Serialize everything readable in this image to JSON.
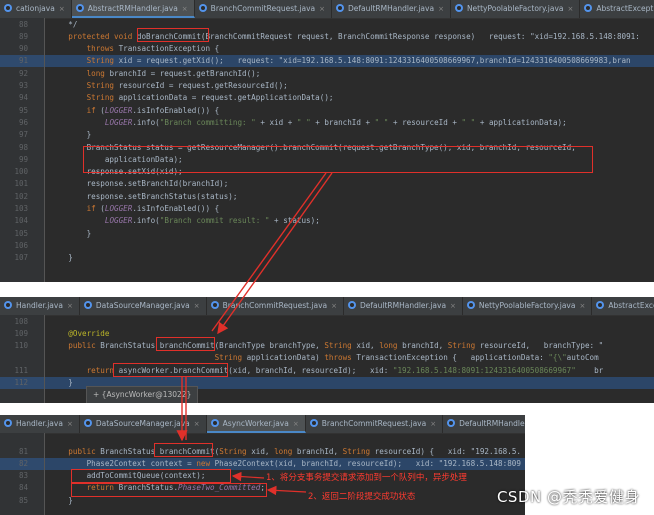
{
  "panel1": {
    "tabs": [
      {
        "label": "cationjava",
        "active": false
      },
      {
        "label": "AbstractRMHandler.java",
        "active": true
      },
      {
        "label": "BranchCommitRequest.java",
        "active": false
      },
      {
        "label": "DefaultRMHandler.java",
        "active": false
      },
      {
        "label": "NettyPoolableFactory.java",
        "active": false
      },
      {
        "label": "AbstractExceptionHandler.java",
        "active": false
      },
      {
        "label": "AbstractT",
        "active": false
      }
    ],
    "lines": [
      {
        "n": "88",
        "code": "    */"
      },
      {
        "n": "89",
        "code": "    protected void doBranchCommit(BranchCommitRequest request, BranchCommitResponse response)   request: \"xid=192.168.5.148:8091:"
      },
      {
        "n": "90",
        "code": "        throws TransactionException {"
      },
      {
        "n": "91",
        "code": "        String xid = request.getXid();   request: \"xid=192.168.5.148:8091:1243316400508669967,branchId=1243316400508669983,bran"
      },
      {
        "n": "92",
        "code": "        long branchId = request.getBranchId();"
      },
      {
        "n": "93",
        "code": "        String resourceId = request.getResourceId();"
      },
      {
        "n": "94",
        "code": "        String applicationData = request.getApplicationData();"
      },
      {
        "n": "95",
        "code": "        if (LOGGER.isInfoEnabled()) {"
      },
      {
        "n": "96",
        "code": "            LOGGER.info(\"Branch committing: \" + xid + \" \" + branchId + \" \" + resourceId + \" \" + applicationData);"
      },
      {
        "n": "97",
        "code": "        }"
      },
      {
        "n": "98",
        "code": "        BranchStatus status = getResourceManager().branchCommit(request.getBranchType(), xid, branchId, resourceId,"
      },
      {
        "n": "99",
        "code": "            applicationData);"
      },
      {
        "n": "100",
        "code": "        response.setXid(xid);"
      },
      {
        "n": "101",
        "code": "        response.setBranchId(branchId);"
      },
      {
        "n": "102",
        "code": "        response.setBranchStatus(status);"
      },
      {
        "n": "103",
        "code": "        if (LOGGER.isInfoEnabled()) {"
      },
      {
        "n": "104",
        "code": "            LOGGER.info(\"Branch commit result: \" + status);"
      },
      {
        "n": "105",
        "code": "        }"
      },
      {
        "n": "106",
        "code": ""
      },
      {
        "n": "107",
        "code": "    }"
      }
    ]
  },
  "panel2": {
    "tabs": [
      {
        "label": "Handler.java",
        "active": false
      },
      {
        "label": "DataSourceManager.java",
        "active": false
      },
      {
        "label": "BranchCommitRequest.java",
        "active": false
      },
      {
        "label": "DefaultRMHandler.java",
        "active": false
      },
      {
        "label": "NettyPoolableFactory.java",
        "active": false
      },
      {
        "label": "AbstractExceptionHandler.java",
        "active": false
      }
    ],
    "lines": [
      {
        "n": "108",
        "code": ""
      },
      {
        "n": "109",
        "code": "    @Override"
      },
      {
        "n": "110",
        "code": "    public BranchStatus branchCommit(BranchType branchType, String xid, long branchId, String resourceId,   branchType: \""
      },
      {
        "n": "",
        "code": "                                    String applicationData) throws TransactionException {   applicationData: \"{\\\"autoCom"
      },
      {
        "n": "111",
        "code": "        return asyncWorker.branchCommit(xid, branchId, resourceId);   xid: \"192.168.5.148:8091:1243316400508669967\"    br"
      },
      {
        "n": "112",
        "code": "    }"
      }
    ],
    "tooltip": "+ {AsyncWorker@13022}"
  },
  "panel3": {
    "tabs": [
      {
        "label": "Handler.java",
        "active": false
      },
      {
        "label": "DataSourceManager.java",
        "active": false
      },
      {
        "label": "AsyncWorker.java",
        "active": true
      },
      {
        "label": "BranchCommitRequest.java",
        "active": false
      },
      {
        "label": "DefaultRMHandler.java",
        "active": false
      },
      {
        "label": "NettyPoolableFactory.java",
        "active": false
      }
    ],
    "lines": [
      {
        "n": "81",
        "code": "    public BranchStatus branchCommit(String xid, long branchId, String resourceId) {   xid: \"192.168.5."
      },
      {
        "n": "82",
        "code": "        Phase2Context context = new Phase2Context(xid, branchId, resourceId);   xid: \"192.168.5.148:809"
      },
      {
        "n": "83",
        "code": "        addToCommitQueue(context);"
      },
      {
        "n": "84",
        "code": "        return BranchStatus.PhaseTwo_Committed;"
      },
      {
        "n": "85",
        "code": "    }"
      }
    ],
    "annotations": [
      "1、将分支事务提交请求添加到一个队列中，异步处理",
      "2、返回二阶段提交成功状态"
    ]
  },
  "watermark": "CSDN @秃秃爱健身",
  "colors": {
    "editor_bg": "#2b2b2b",
    "tabbar_bg": "#3c3f41",
    "keyword": "#cc7832",
    "string": "#6a8759",
    "annotation_red": "#ff3b30",
    "highlight": "#2d5d9a"
  }
}
